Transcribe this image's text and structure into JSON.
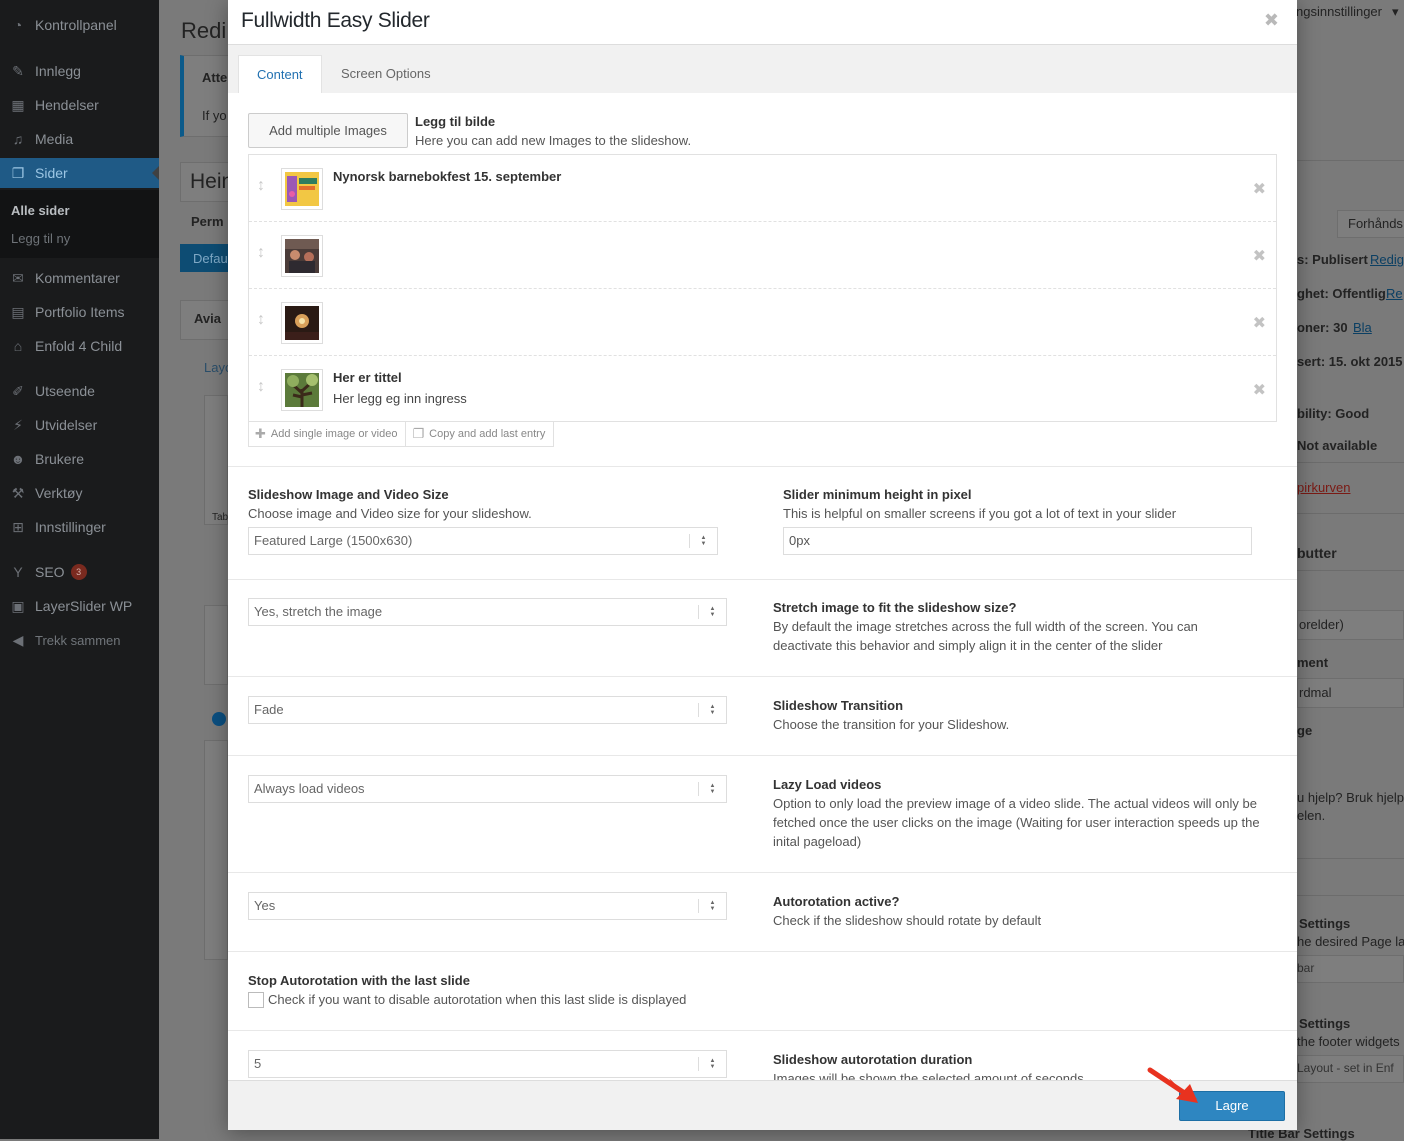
{
  "sidebar": {
    "items": [
      {
        "label": "Kontrollpanel",
        "icon": "dashboard-icon"
      },
      {
        "label": "Innlegg",
        "icon": "pin-icon"
      },
      {
        "label": "Hendelser",
        "icon": "calendar-icon"
      },
      {
        "label": "Media",
        "icon": "media-icon"
      },
      {
        "label": "Sider",
        "icon": "pages-icon"
      },
      {
        "label": "Kommentarer",
        "icon": "comments-icon"
      },
      {
        "label": "Portfolio Items",
        "icon": "portfolio-icon"
      },
      {
        "label": "Enfold 4 Child",
        "icon": "home-icon"
      },
      {
        "label": "Utseende",
        "icon": "brush-icon"
      },
      {
        "label": "Utvidelser",
        "icon": "plugin-icon"
      },
      {
        "label": "Brukere",
        "icon": "user-icon"
      },
      {
        "label": "Verktøy",
        "icon": "wrench-icon"
      },
      {
        "label": "Innstillinger",
        "icon": "settings-icon"
      },
      {
        "label": "SEO",
        "icon": "yoast-icon",
        "badge": "3"
      },
      {
        "label": "LayerSlider WP",
        "icon": "layers-icon"
      },
      {
        "label": "Trekk sammen",
        "icon": "collapse-icon"
      }
    ],
    "submenu": [
      "Alle sider",
      "Legg til ny"
    ]
  },
  "background": {
    "page_heading": "Redi",
    "notice_title": "Atte",
    "notice_text": "If yo",
    "title_field": "Hein",
    "permalink": "Perm",
    "default_btn": "Defau",
    "avia_box": "Avia",
    "layout_tab": "Layo",
    "tab_label": "Tab",
    "screen_options": "ngsinnstillinger",
    "preview_btn": "Forhånds",
    "status": "s: Publisert",
    "status_link": "Redig",
    "visibility": "ghet: Offentlig",
    "visibility_link": "Re",
    "revisions": "oner: 30",
    "revisions_link": "Bla",
    "published": "sert: 15. okt 2015",
    "readability": "bility: Good",
    "seo_na": "Not available",
    "trash_link": "pirkurven",
    "attributes": "butter",
    "parent": "orelder)",
    "template": "ment",
    "template_val": "rdmal",
    "order": "ge",
    "help": "u hjelp? Bruk hjelp",
    "help2": "elen.",
    "layout_settings": "Settings",
    "layout_settings_desc": "he desired Page la",
    "sidebar_val": "bar",
    "footer_settings": "Settings",
    "footer_desc": "the footer widgets",
    "footer_val": "Layout - set in Enf",
    "titlebar": "Title Bar Settings"
  },
  "modal": {
    "title": "Fullwidth Easy Slider",
    "tabs": [
      "Content",
      "Screen Options"
    ],
    "add_multiple_label": "Add multiple Images",
    "add_image_heading": "Legg til bilde",
    "add_image_desc": "Here you can add new Images to the slideshow.",
    "slides": [
      {
        "title": "Nynorsk barnebokfest 15. september",
        "subtitle": ""
      },
      {
        "title": "",
        "subtitle": ""
      },
      {
        "title": "",
        "subtitle": ""
      },
      {
        "title": "Her er tittel",
        "subtitle": "Her legg eg inn ingress"
      }
    ],
    "add_single_label": "Add single image or video",
    "copy_last_label": "Copy and add last entry",
    "size_heading": "Slideshow Image and Video Size",
    "size_desc": "Choose image and Video size for your slideshow.",
    "size_value": "Featured Large (1500x630)",
    "min_height_heading": "Slider minimum height in pixel",
    "min_height_desc": "This is helpful on smaller screens if you got a lot of text in your slider",
    "min_height_value": "0px",
    "stretch_value": "Yes, stretch the image",
    "stretch_heading": "Stretch image to fit the slideshow size?",
    "stretch_desc": "By default the image stretches across the full width of the screen. You can deactivate this behavior and simply align it in the center of the slider",
    "transition_value": "Fade",
    "transition_heading": "Slideshow Transition",
    "transition_desc": "Choose the transition for your Slideshow.",
    "lazy_value": "Always load videos",
    "lazy_heading": "Lazy Load videos",
    "lazy_desc": "Option to only load the preview image of a video slide. The actual videos will only be fetched once the user clicks on the image (Waiting for user interaction speeds up the inital pageload)",
    "autorotation_value": "Yes",
    "autorotation_heading": "Autorotation active?",
    "autorotation_desc": "Check if the slideshow should rotate by default",
    "stop_heading": "Stop Autorotation with the last slide",
    "stop_desc": "Check if you want to disable autorotation when this last slide is displayed",
    "duration_value": "5",
    "duration_heading": "Slideshow autorotation duration",
    "duration_desc": "Images will be shown the selected amount of seconds.",
    "save_label": "Lagre"
  },
  "colors": {
    "accent": "#2e86c1",
    "sidebar_current": "#1f5a86",
    "arrow": "#e8321f"
  }
}
